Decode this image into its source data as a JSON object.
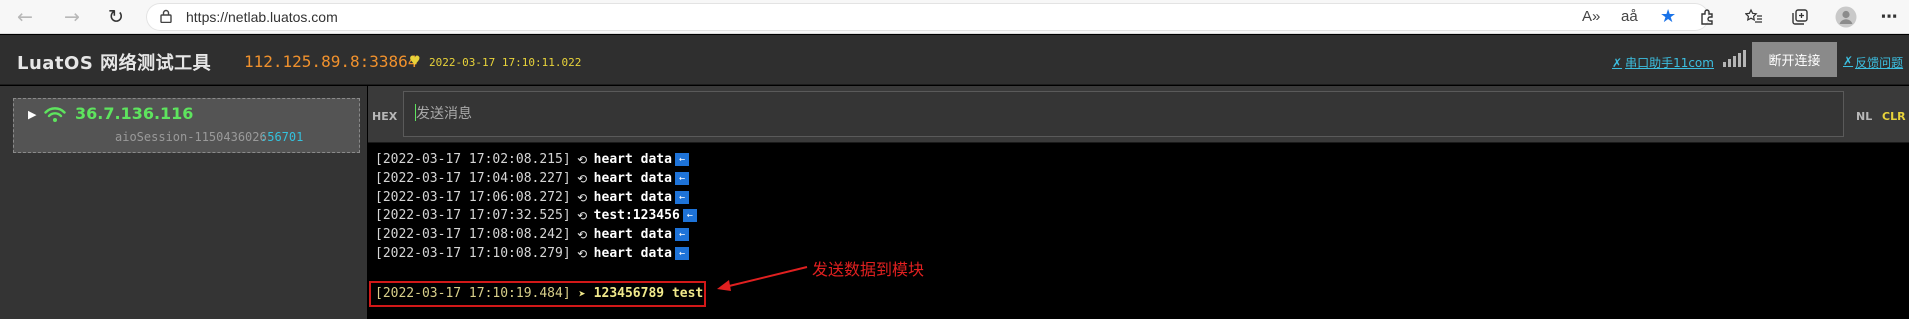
{
  "browser": {
    "url": "https://netlab.luatos.com",
    "read_aloud_label": "A»",
    "translate_label": "aå"
  },
  "header": {
    "title": "LuatOS 网络测试工具",
    "server_address": "112.125.89.8:33864",
    "server_time": "2022-03-17 17:10:11.022",
    "serial_link": "串口助手11com",
    "disconnect_button": "断开连接",
    "feedback_link": "反馈问题"
  },
  "session": {
    "ip": "36.7.136.116",
    "id": "aioSession-1150436026",
    "port": ":56701"
  },
  "send": {
    "hex_label": "HEX",
    "placeholder": "发送消息",
    "nl_label": "NL",
    "clr_label": "CLR"
  },
  "log": [
    {
      "time": "[2022-03-17 17:02:08.215]",
      "text": "heart data",
      "direction": "received"
    },
    {
      "time": "[2022-03-17 17:04:08.227]",
      "text": "heart data",
      "direction": "received"
    },
    {
      "time": "[2022-03-17 17:06:08.272]",
      "text": "heart data",
      "direction": "received"
    },
    {
      "time": "[2022-03-17 17:07:32.525]",
      "text": "test:123456",
      "direction": "received"
    },
    {
      "time": "[2022-03-17 17:08:08.242]",
      "text": "heart data",
      "direction": "received"
    },
    {
      "time": "[2022-03-17 17:10:08.279]",
      "text": "heart data",
      "direction": "received"
    },
    {
      "time": "[2022-03-17 17:10:19.484]",
      "text": "123456789 test",
      "direction": "sent"
    }
  ],
  "annotation": {
    "text": "发送数据到模块"
  },
  "colors": {
    "accent_orange": "#f0912d",
    "ip_green": "#5ee45e",
    "link_cyan": "#3cbfe0",
    "annotation_red": "#e02020"
  }
}
